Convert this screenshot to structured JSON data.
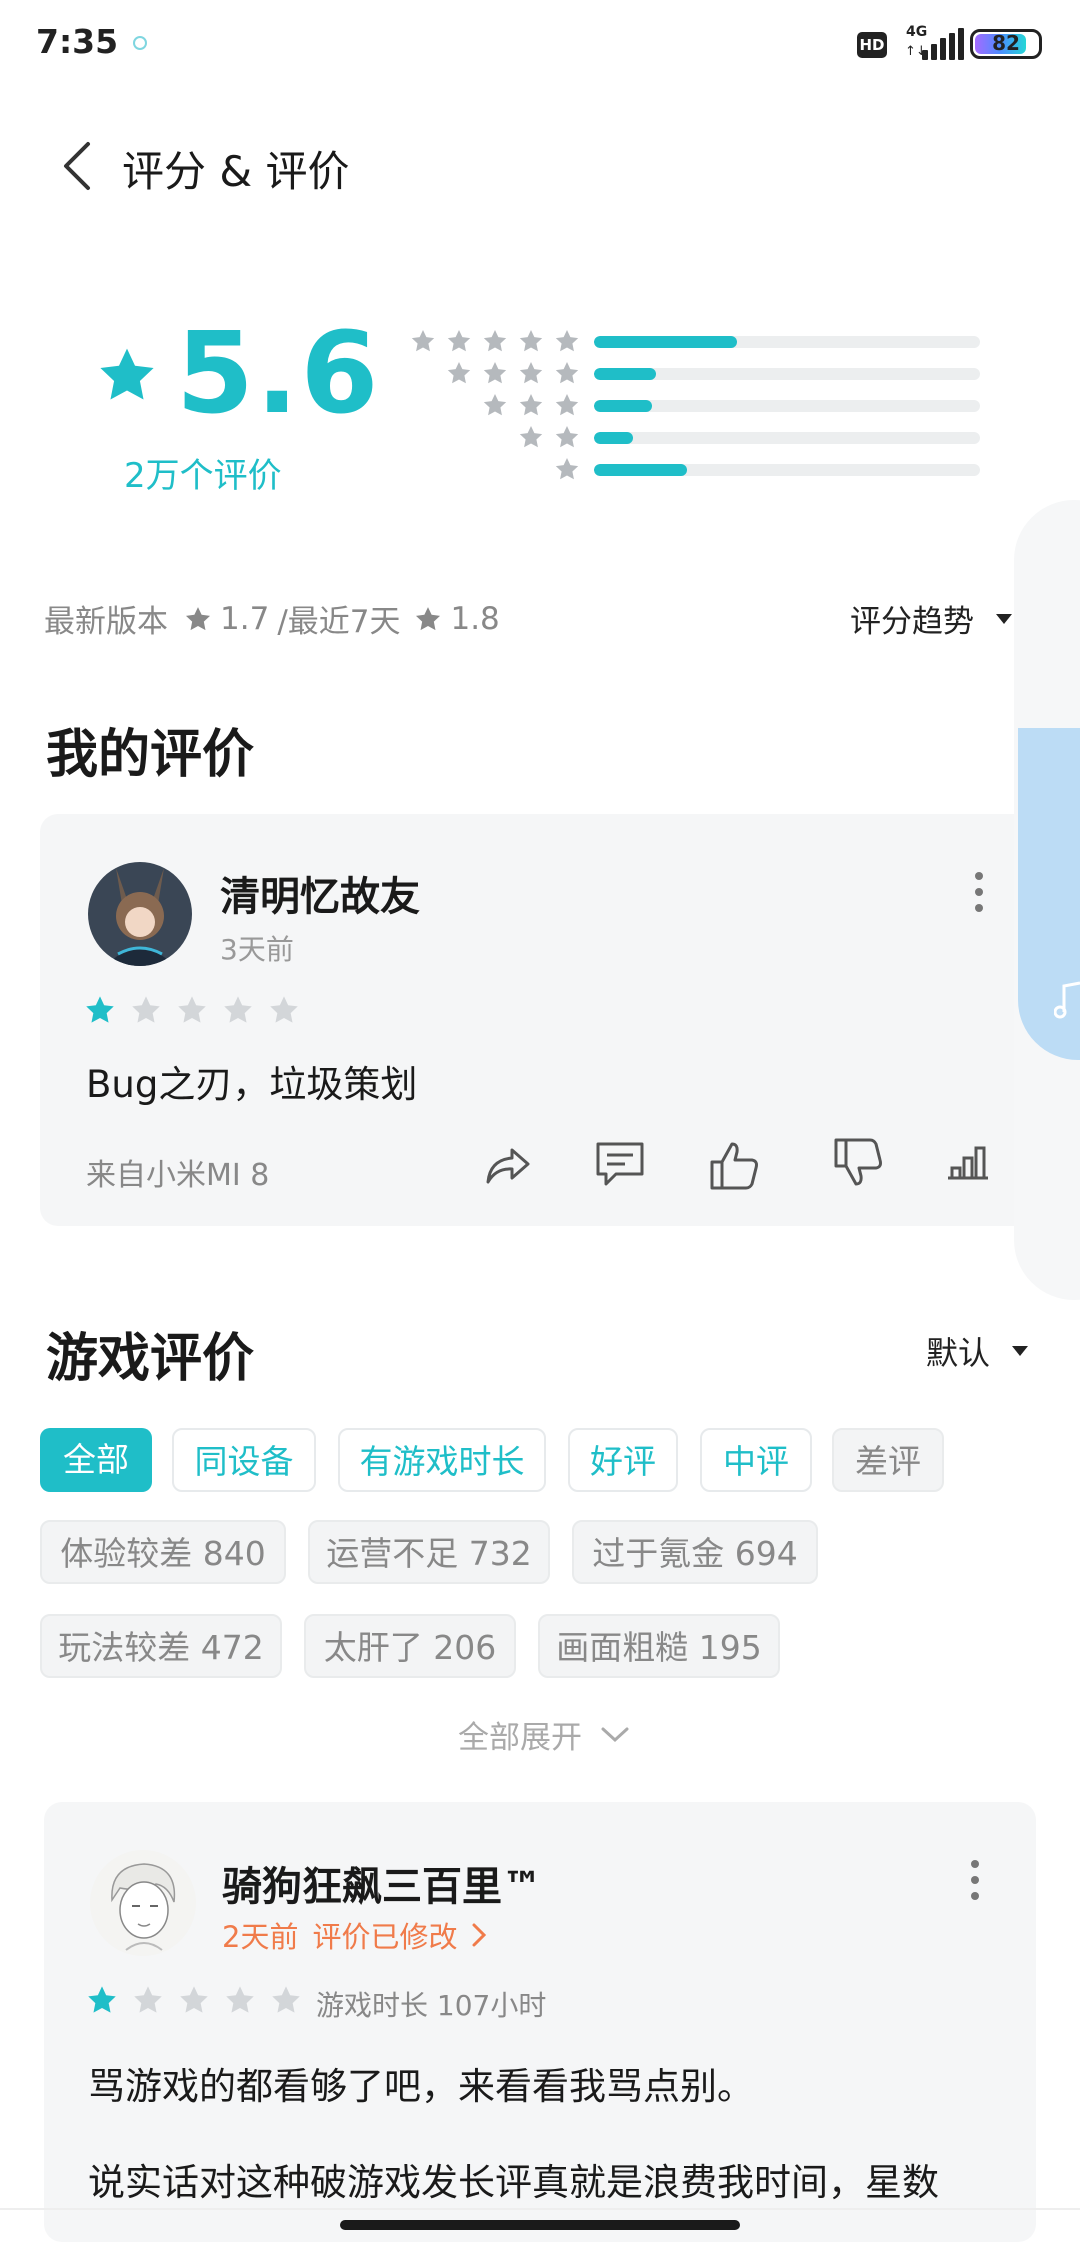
{
  "status_bar": {
    "time": "7:35",
    "hd": "HD",
    "network": "4G",
    "network_arrows": "↑↓",
    "battery": "82"
  },
  "header": {
    "title": "评分 & 评价",
    "back_icon": "back-chevron-icon"
  },
  "rating": {
    "score": "5.6",
    "count": "2万个评价",
    "distribution": [
      {
        "stars": 5,
        "fraction": 0.37
      },
      {
        "stars": 4,
        "fraction": 0.16
      },
      {
        "stars": 3,
        "fraction": 0.15
      },
      {
        "stars": 2,
        "fraction": 0.1
      },
      {
        "stars": 1,
        "fraction": 0.24
      }
    ],
    "version_label": "最新版本",
    "version_score": "1.7",
    "recent_label": "/最近7天",
    "recent_score": "1.8",
    "trend_label": "评分趋势"
  },
  "my_review": {
    "section_title": "我的评价",
    "user_name": "清明忆故友",
    "time": "3天前",
    "stars": 1,
    "text": "Bug之刃，垃圾策划",
    "device": "来自小米MI 8",
    "actions": [
      "share-icon",
      "comment-icon",
      "thumbs-up-icon",
      "thumbs-down-icon",
      "stats-icon"
    ]
  },
  "game_reviews": {
    "section_title": "游戏评价",
    "sort_label": "默认",
    "filters": [
      {
        "label": "全部",
        "state": "active"
      },
      {
        "label": "同设备",
        "state": "teal"
      },
      {
        "label": "有游戏时长",
        "state": "teal"
      },
      {
        "label": "好评",
        "state": "teal"
      },
      {
        "label": "中评",
        "state": "teal"
      },
      {
        "label": "差评",
        "state": "gray"
      }
    ],
    "tags_row1": [
      "体验较差 840",
      "运营不足 732",
      "过于氪金 694"
    ],
    "tags_row2": [
      "玩法较差 472",
      "太肝了 206",
      "画面粗糙 195"
    ],
    "expand_label": "全部展开"
  },
  "review_1": {
    "user_name": "骑狗狂飙三百里™",
    "time": "2天前",
    "edited": "评价已修改",
    "stars": 1,
    "play_time": "游戏时长 107小时",
    "text_line1": "骂游戏的都看够了吧，来看看我骂点别。",
    "text_line2": "说实话对这种破游戏发长评真就是浪费我时间，星数"
  },
  "colors": {
    "accent": "#1fbec8",
    "edited": "#f07b4a",
    "card_bg": "#f5f6f7",
    "star_off": "#d3d6d9"
  }
}
